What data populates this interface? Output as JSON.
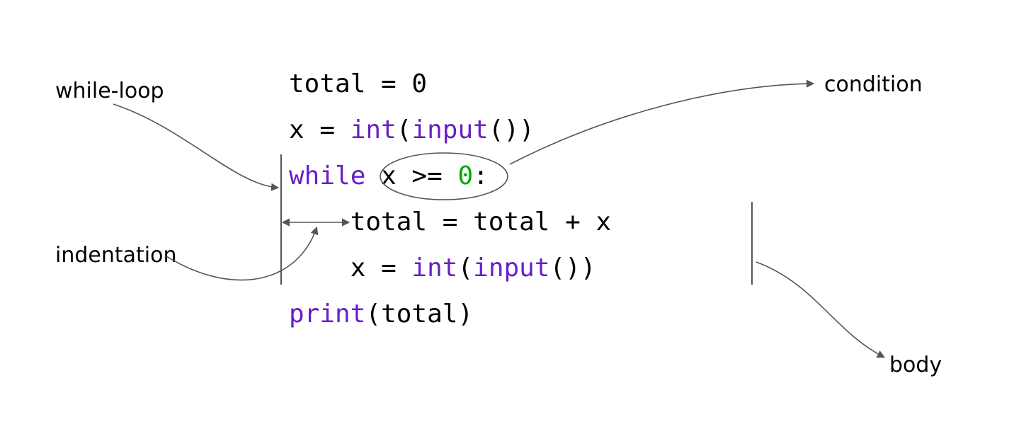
{
  "labels": {
    "while_loop": "while-loop",
    "indentation": "indentation",
    "condition": "condition",
    "body": "body"
  },
  "code": {
    "line1": {
      "total": "total",
      "eq": " = ",
      "zero": "0"
    },
    "line2": {
      "x": "x",
      "eq": " = ",
      "int": "int",
      "lp": "(",
      "input": "input",
      "rp": "()",
      "cp": ")"
    },
    "line3": {
      "while": "while",
      "sp": " ",
      "cond_x": "x",
      "cond_op": " >= ",
      "cond_zero": "0",
      "colon": ":"
    },
    "line4": {
      "indent": "    ",
      "total1": "total",
      "eq": " = ",
      "total2": "total",
      "plus": " + ",
      "x": "x"
    },
    "line5": {
      "indent": "    ",
      "x": "x",
      "eq": " = ",
      "int": "int",
      "lp": "(",
      "input": "input",
      "rp": "()",
      "cp": ")"
    },
    "line6": {
      "print": "print",
      "lp": "(",
      "total": "total",
      "rp": ")"
    }
  },
  "annotations": {
    "while_loop_target": "while keyword",
    "condition_target": "x >= 0",
    "indentation_target": "4-space indent",
    "body_target": "loop body block"
  }
}
